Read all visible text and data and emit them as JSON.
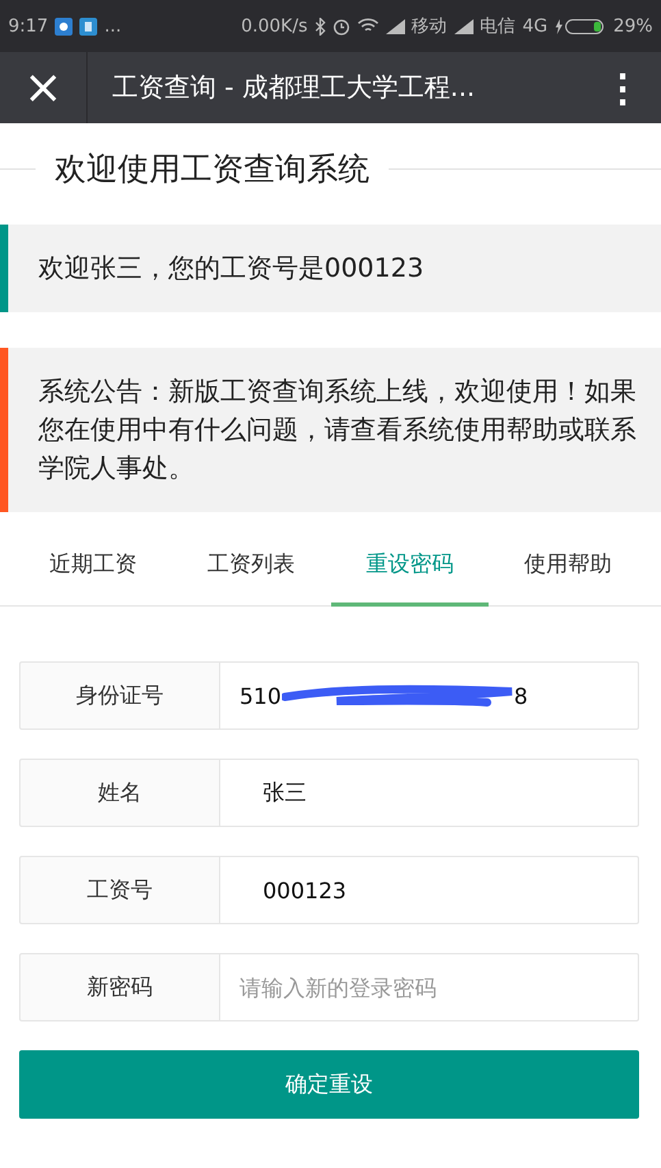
{
  "status_bar": {
    "time": "9:17",
    "more": "...",
    "speed": "0.00K/s",
    "carrier_1": "移动",
    "carrier_2": "电信",
    "network": "4G",
    "battery": "29%"
  },
  "title_bar": {
    "close": "×",
    "title": "工资查询 - 成都理工大学工程...",
    "menu": "⋮"
  },
  "heading": "欢迎使用工资查询系统",
  "notices": [
    {
      "text": "欢迎张三，您的工资号是000123",
      "color": "#009688"
    },
    {
      "text": "系统公告：新版工资查询系统上线，欢迎使用！如果您在使用中有什么问题，请查看系统使用帮助或联系学院人事处。",
      "color": "#ff5722"
    }
  ],
  "tabs": [
    {
      "label": "近期工资",
      "selected": false
    },
    {
      "label": "工资列表",
      "selected": false
    },
    {
      "label": "重设密码",
      "selected": true
    },
    {
      "label": "使用帮助",
      "selected": false
    }
  ],
  "form": [
    {
      "label": "身份证号",
      "kind": "redacted",
      "value_start": "510",
      "value_end": "8"
    },
    {
      "label": "姓名",
      "kind": "value",
      "value": "张三"
    },
    {
      "label": "工资号",
      "kind": "value",
      "value": "000123"
    },
    {
      "label": "新密码",
      "kind": "input",
      "placeholder": "请输入新的登录密码"
    }
  ],
  "submit": "确定重设"
}
